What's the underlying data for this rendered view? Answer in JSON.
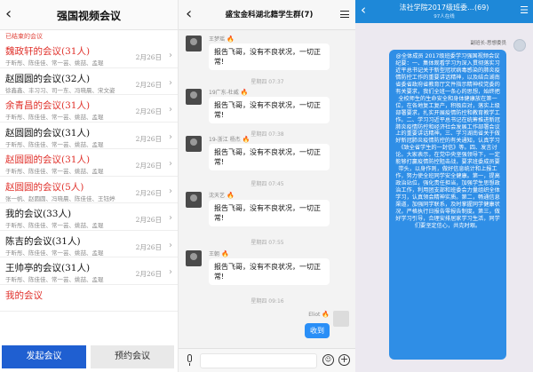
{
  "panel1": {
    "title": "强国视频会议",
    "section_label": "已结束的会议",
    "meetings": [
      {
        "title": "魏政轩的会议(31人)",
        "members": "于昕彤、陈佳佳、常一芸、姚喆、孟琨",
        "date": "2月26日",
        "color": "red"
      },
      {
        "title": "赵圆圆的会议(32人)",
        "members": "徐鑫鑫、丰习习、司一东、冯晓晨、宋文姿",
        "date": "2月26日",
        "color": "dark"
      },
      {
        "title": "余青昌的会议(31人)",
        "members": "于昕彤、陈佳佳、常一芸、姚喆、孟琨",
        "date": "2月26日",
        "color": "red"
      },
      {
        "title": "赵圆圆的会议(31人)",
        "members": "于昕彤、陈佳佳、常一芸、姚喆、孟琨",
        "date": "2月26日",
        "color": "dark"
      },
      {
        "title": "赵圆圆的会议(31人)",
        "members": "于昕彤、陈佳佳、常一芸、姚喆、孟琨",
        "date": "2月26日",
        "color": "red"
      },
      {
        "title": "赵圆圆的会议(5人)",
        "members": "张一帆、赵圆圆、冯晓晨、陈佳佳、王钰婷",
        "date": "2月26日",
        "color": "red"
      },
      {
        "title": "我的会议(33人)",
        "members": "于昕彤、陈佳佳、常一芸、姚喆、孟琨",
        "date": "2月26日",
        "color": "dark"
      },
      {
        "title": "陈吉的会议(31人)",
        "members": "于昕彤、陈佳佳、常一芸、姚喆、孟琨",
        "date": "2月26日",
        "color": "dark"
      },
      {
        "title": "王帅亭的会议(31人)",
        "members": "于昕彤、陈佳佳、常一芸、姚喆、孟琨",
        "date": "2月26日",
        "color": "dark"
      },
      {
        "title": "我的会议",
        "members": "",
        "date": "",
        "color": "red"
      }
    ],
    "start_button": "发起会议",
    "book_button": "预约会议"
  },
  "panel2": {
    "title": "盛宝金科湖北籍学生群(7)",
    "messages": [
      {
        "sender": "王梦瑶",
        "text": "报告飞哥，没有不良状况，一切正常!"
      },
      {
        "sender": "19广东-杜威",
        "text": "报告飞哥，没有不良状况，一切正常!"
      },
      {
        "sender": "19-浙江 杨杰",
        "text": "报告飞哥，没有不良状况，一切正常!"
      },
      {
        "sender": "沈天艺",
        "text": "报告飞哥，没有不良状况，一切正常!"
      },
      {
        "sender": "王朝",
        "text": "报告飞哥，没有不良状况，一切正常!"
      }
    ],
    "timestamps": [
      "星期四 07:37",
      "星期四 07:38",
      "星期四 07:45",
      "星期四 07:55",
      "星期四 09:16"
    ],
    "self_name": "Eliot",
    "self_reply": "收到",
    "emoji_glyph": "☺",
    "plus_glyph": "+"
  },
  "panel3": {
    "title": "法社学院2017级班委…(69)",
    "subtitle": "97人在线",
    "sender": "副班长-思想委员",
    "message": "@全体成员 2017级班委学习强国视频会议纪要：一、集体观看学习为深入贯彻落实习近平总书记关于新型冠状病毒感染的肺炎疫情防控工作的重要讲话精神，以及结合湖南省委省政府省教育厅文件指示精神校党委的有关要求，我们全班一条心的思想，始终把全校师生的生命安全和身体健康放在第一位，在各地复工复产，积极应对，落实上级部署要求，扎实开展疫情防控和教育教学工作。二、学习习近平总书记在统筹推进新冠肺炎疫情防控和经济社会发展工作部署会议上的重要讲话精神。三、学习湖南省关于做好新冠肺炎疫情防控的有关通知，认真学习《致全省学生的一封信》等。四、发言讨论。大家表示，在党中央坚强领导下，一定能够打赢疫情防控阻击战，要求班委成员要带头，以身作则，做好信息统计和上报工作，努力使全班同学安全健康。第一，提高政治站位，强化责任担当，加强学生思想政治工作，利用团支部和班委会力量组织全体学习，认真领会精神实质。第二，畅通信息渠道，加强同学联系，及时掌握同学健康状况，严格执行日报告零报告制度。第三，做好学习引导，合理安排居家学习生活，同学们要坚定信心，共克时艰。"
  }
}
